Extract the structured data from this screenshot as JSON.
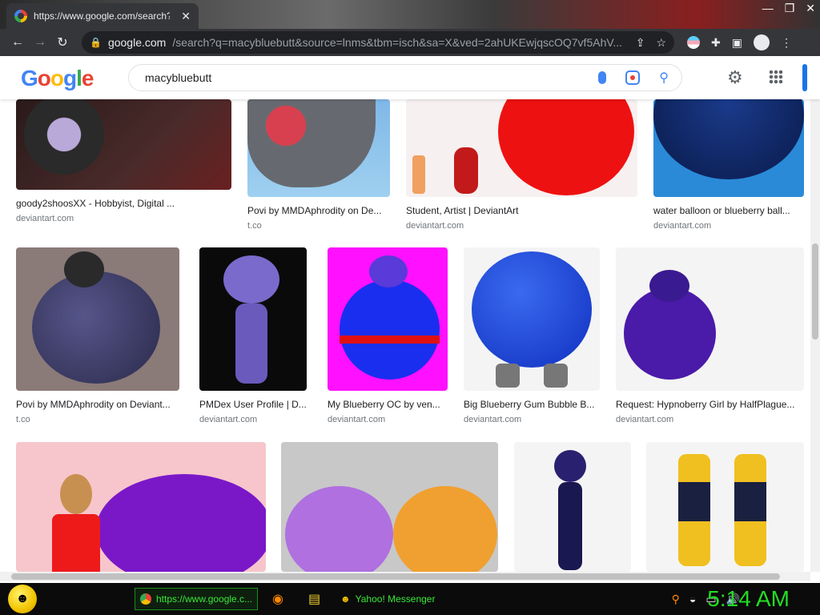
{
  "browser": {
    "tab_title": "https://www.google.com/search?",
    "tab_close": "✕",
    "url_host": "google.com",
    "url_rest": "/search?q=macybluebutt&source=lnms&tbm=isch&sa=X&ved=2ahUKEwjqscOQ7vf5AhV...",
    "win_minimize": "—",
    "win_restore": "❐",
    "win_close": "✕"
  },
  "search": {
    "query": "macybluebutt"
  },
  "results": [
    {
      "title": "goody2shoosXX - Hobbyist, Digital ...",
      "source": "deviantart.com"
    },
    {
      "title": "Povi by MMDAphrodity on De...",
      "source": "t.co"
    },
    {
      "title": "Student, Artist | DeviantArt",
      "source": "deviantart.com"
    },
    {
      "title": "water balloon or blueberry ball...",
      "source": "deviantart.com"
    },
    {
      "title": "Povi by MMDAphrodity on Deviant...",
      "source": "t.co"
    },
    {
      "title": "PMDex User Profile | D...",
      "source": "deviantart.com"
    },
    {
      "title": "My Blueberry OC by ven...",
      "source": "deviantart.com"
    },
    {
      "title": "Big Blueberry Gum Bubble B...",
      "source": "deviantart.com"
    },
    {
      "title": "Request: Hypnoberry Girl by HalfPlague...",
      "source": "deviantart.com"
    }
  ],
  "taskbar": {
    "chrome_task": "https://www.google.c...",
    "yahoo_task": "Yahoo! Messenger",
    "clock": "5:14 AM"
  }
}
